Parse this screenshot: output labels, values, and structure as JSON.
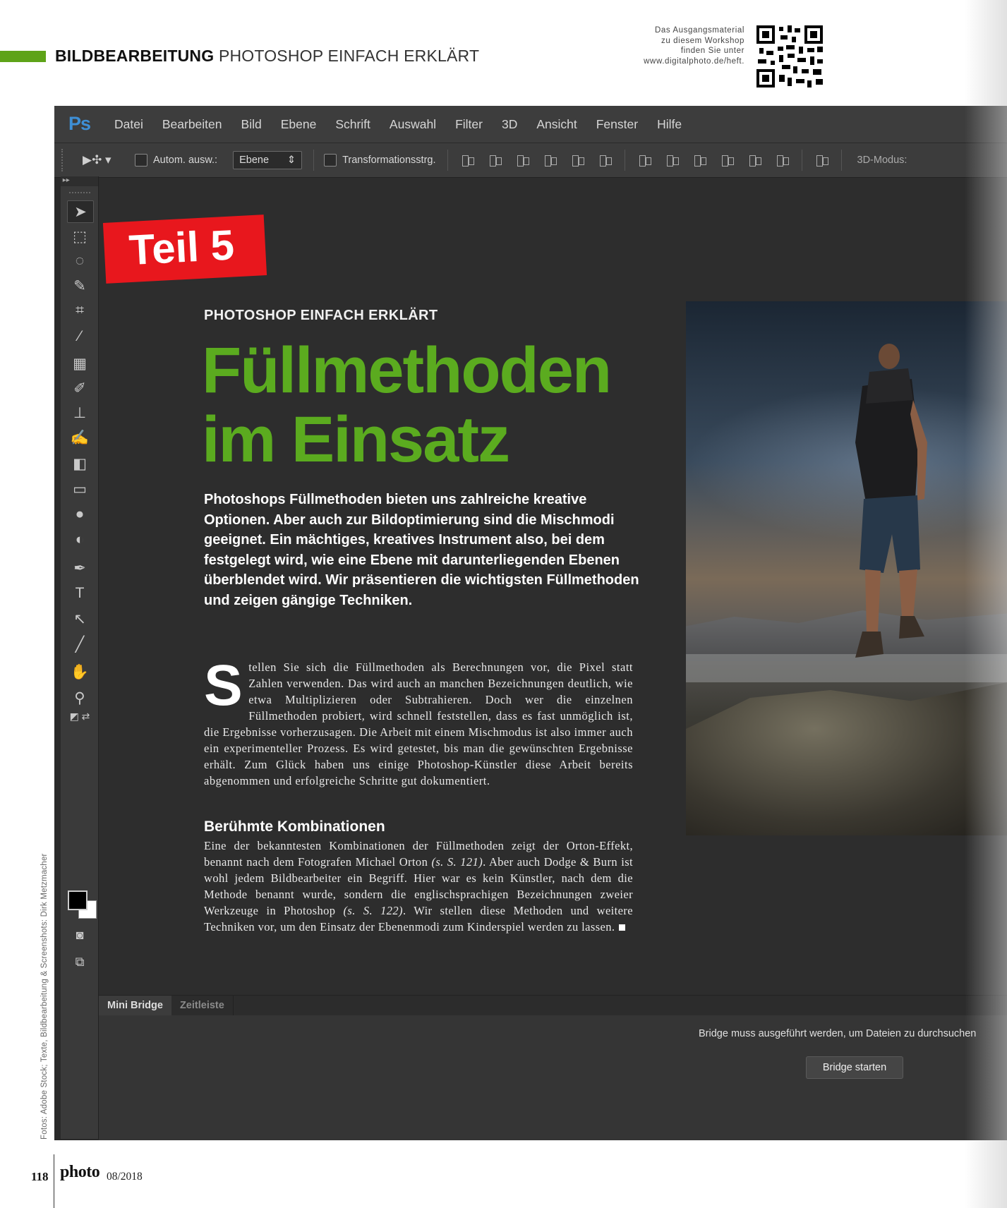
{
  "header": {
    "section": "BILDBEARBEITUNG",
    "topic": "PHOTOSHOP EINFACH ERKLÄRT",
    "qr_note_lines": [
      "Das Ausgangsmaterial",
      "zu diesem Workshop",
      "finden Sie unter",
      "www.digitalphoto.de/heft."
    ]
  },
  "photoshop": {
    "logo": "Ps",
    "menu": [
      "Datei",
      "Bearbeiten",
      "Bild",
      "Ebene",
      "Schrift",
      "Auswahl",
      "Filter",
      "3D",
      "Ansicht",
      "Fenster",
      "Hilfe"
    ],
    "options": {
      "auto_select_label": "Autom. ausw.:",
      "auto_select_value": "Ebene",
      "transform_label": "Transformationsstrg.",
      "mode_3d_label": "3D-Modus:"
    },
    "panel_tabs": [
      "Mini Bridge",
      "Zeitleiste"
    ],
    "bridge_message": "Bridge muss ausgeführt werden, um Dateien zu durchsuchen",
    "bridge_button": "Bridge starten"
  },
  "article": {
    "badge": "Teil 5",
    "kicker": "PHOTOSHOP EINFACH ERKLÄRT",
    "title_line1": "Füllmethoden",
    "title_line2": "im Einsatz",
    "lead": "Photoshops Füllmethoden bieten uns zahlreiche kreative Optionen. Aber auch zur Bildoptimierung sind die Mischmodi geeignet. Ein mächtiges, kreatives Instrument also, bei dem festgelegt wird, wie eine Ebene mit darunterliegenden Ebenen überblendet wird. Wir präsentieren die wichtigsten Füllmethoden und zeigen gängige Techniken.",
    "dropcap": "S",
    "body1": "tellen Sie sich die Füllmethoden als Berechnungen vor, die Pixel statt Zahlen verwenden. Das wird auch an manchen Bezeichnungen deutlich, wie etwa Multiplizieren oder Subtrahieren. Doch wer die einzelnen Füllmethoden probiert, wird schnell feststellen, dass es fast unmöglich ist, die Ergebnisse vorherzusagen. Die Arbeit mit einem Mischmodus ist also immer auch ein experimenteller Prozess. Es wird getestet, bis man die gewünschten Ergebnisse erhält. Zum Glück haben uns einige Photoshop-Künstler diese Arbeit bereits abgenommen und erfolgreiche Schritte gut dokumentiert.",
    "subhead": "Berühmte Kombinationen",
    "body2_a": "Eine der bekanntesten Kombinationen der Füllmethoden zeigt der Orton-Effekt,  benannt nach dem Fotografen Michael Orton ",
    "body2_ref1": "(s. S. 121)",
    "body2_b": ". Aber auch Dodge & Burn ist wohl jedem Bildbearbeiter ein Begriff. Hier war es kein Künstler, nach dem die Methode benannt wurde, sondern die englischsprachigen Bezeichnungen zweier Werkzeuge in Photoshop ",
    "body2_ref2": "(s. S. 122)",
    "body2_c": ". Wir stellen diese Methoden und weitere Techniken vor, um den Einsatz der Ebenenmodi zum Kinderspiel werden zu lassen."
  },
  "credit": "Fotos: Adobe Stock; Texte, Bildbearbeitung & Screenshots: Dirk Metzmacher",
  "footer": {
    "page_number": "118",
    "brand": "photo",
    "issue": "08/2018"
  },
  "colors": {
    "accent_green": "#5bab1f",
    "badge_red": "#e8171d",
    "ps_blue": "#3e8fd6"
  }
}
